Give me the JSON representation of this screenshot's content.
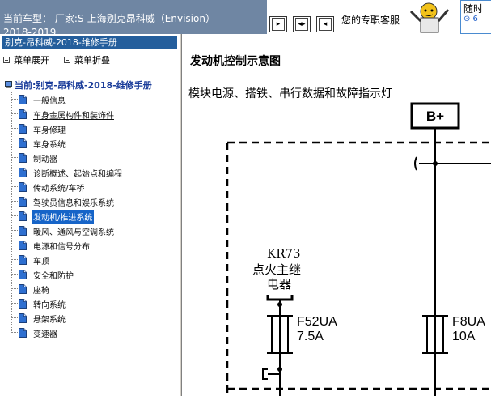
{
  "header": {
    "vehicle_line1": "当前车型： 厂家:S-上海别克昂科威（Envision）",
    "vehicle_line2": "2018-2019",
    "service_text": "您的专职客服",
    "call_text": "随时",
    "call_sub": "⊙ 6"
  },
  "sidebar": {
    "book_title": "别克-昂科威-2018-维修手册",
    "expand_label": "菜单展开",
    "collapse_label": "菜单折叠",
    "current_label": "当前:别克-昂科威-2018-维修手册",
    "items": [
      {
        "label": "一般信息"
      },
      {
        "label": "车身金属构件和装饰件"
      },
      {
        "label": "车身修理"
      },
      {
        "label": "车身系统"
      },
      {
        "label": "制动器"
      },
      {
        "label": "诊断概述、起始点和编程"
      },
      {
        "label": "传动系统/车桥"
      },
      {
        "label": "驾驶员信息和娱乐系统"
      },
      {
        "label": "发动机/推进系统"
      },
      {
        "label": "暖风、通风与空调系统"
      },
      {
        "label": "电源和信号分布"
      },
      {
        "label": "车顶"
      },
      {
        "label": "安全和防护"
      },
      {
        "label": "座椅"
      },
      {
        "label": "转向系统"
      },
      {
        "label": "悬架系统"
      },
      {
        "label": "变速器"
      }
    ]
  },
  "content": {
    "title": "发动机控制示意图",
    "subtitle": "模块电源、搭铁、串行数据和故障指示灯",
    "diagram": {
      "battery_label": "B+",
      "relay_id": "KR73",
      "relay_name_1": "点火主继",
      "relay_name_2": "电器",
      "fuse1_name": "F52UA",
      "fuse1_rating": "7.5A",
      "fuse2_name": "F8UA",
      "fuse2_rating": "10A"
    }
  },
  "colors": {
    "header_bg": "#6f86a3",
    "title_bar": "#245e9c",
    "selection": "#1664c8"
  }
}
